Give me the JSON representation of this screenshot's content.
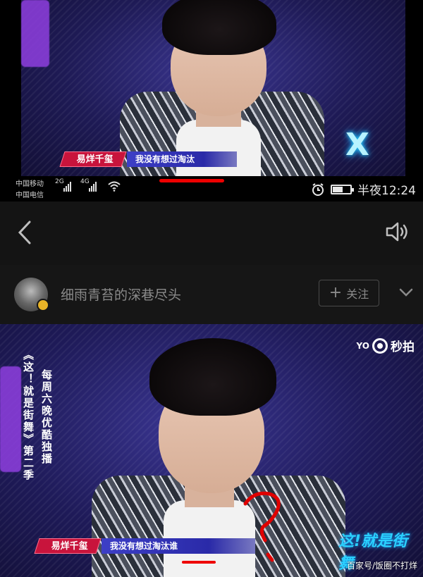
{
  "top_video": {
    "name_tag": "易烊千玺",
    "subtitle": "我没有想过淘汰",
    "logo_glyph": "X"
  },
  "status_bar": {
    "carrier_1": "中国移动",
    "carrier_2": "中国电信",
    "net_1": "2G",
    "net_2": "4G",
    "time": "半夜12:24",
    "battery_level": 0.6
  },
  "app_bar": {
    "back_icon": "chevron-left-icon",
    "speaker_icon": "speaker-icon"
  },
  "user_row": {
    "username": "细雨青苔的深巷尽头",
    "follow_label": "关注",
    "expand_icon": "chevron-down-icon"
  },
  "bottom_video": {
    "side_caption_1": "每周六晚优酷独播",
    "side_caption_2": "《这！就是街舞》第二季",
    "watermark_you": "YO",
    "watermark_text": "秒拍",
    "name_tag": "易烊千玺",
    "subtitle": "我没有想过淘汰谁",
    "show_logo": "这!就是街舞",
    "credit": "百家号/饭圈不打烊"
  },
  "colors": {
    "accent_red": "#c8143c",
    "annotation_red": "#e00000",
    "subtitle_blue": "#3d3fc6"
  }
}
